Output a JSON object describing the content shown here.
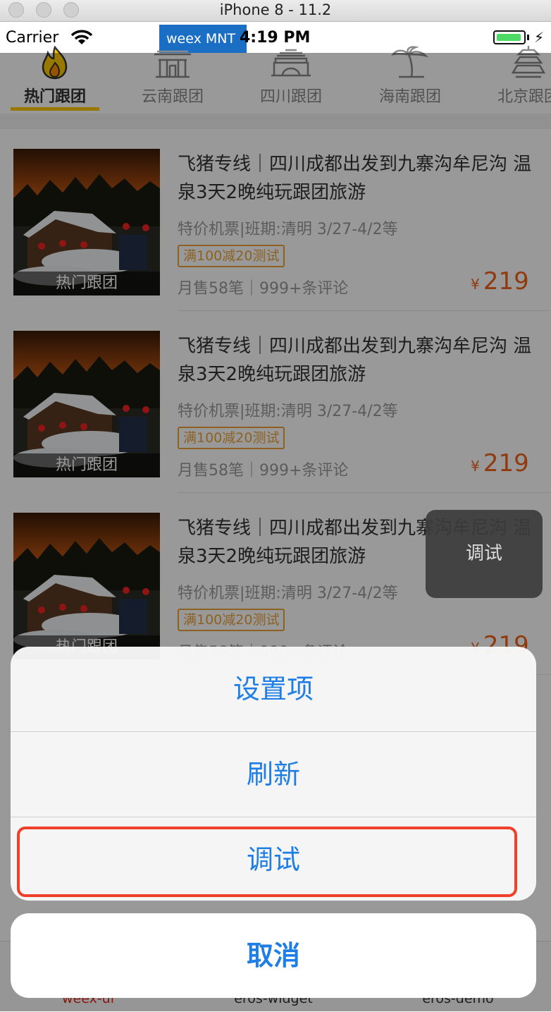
{
  "window": {
    "title": "iPhone 8 - 11.2"
  },
  "status_bar": {
    "carrier": "Carrier",
    "badge": "weex MNT",
    "time": "4:19 PM"
  },
  "category_tabs": [
    {
      "label": "热门跟团",
      "icon": "fire-icon",
      "active": true
    },
    {
      "label": "云南跟团",
      "icon": "temple-gate-icon",
      "active": false
    },
    {
      "label": "四川跟团",
      "icon": "great-wall-icon",
      "active": false
    },
    {
      "label": "海南跟团",
      "icon": "palm-tree-icon",
      "active": false
    },
    {
      "label": "北京跟团",
      "icon": "pagoda-icon",
      "active": false
    }
  ],
  "items": [
    {
      "thumb_label": "热门跟团",
      "title": "飞猪专线｜四川成都出发到九寨沟牟尼沟 温泉3天2晚纯玩跟团旅游",
      "subtitle": "特价机票|班期:清明 3/27-4/2等",
      "coupon": "满100减20测试",
      "sales": "月售58笔｜999+条评论",
      "price_symbol": "¥",
      "price": "219"
    },
    {
      "thumb_label": "热门跟团",
      "title": "飞猪专线｜四川成都出发到九寨沟牟尼沟 温泉3天2晚纯玩跟团旅游",
      "subtitle": "特价机票|班期:清明 3/27-4/2等",
      "coupon": "满100减20测试",
      "sales": "月售58笔｜999+条评论",
      "price_symbol": "¥",
      "price": "219"
    },
    {
      "thumb_label": "热门跟团",
      "title": "飞猪专线｜四川成都出发到九寨沟牟尼沟 温泉3天2晚纯玩跟团旅游",
      "subtitle": "特价机票|班期:清明 3/27-4/2等",
      "coupon": "满100减20测试",
      "sales": "月售58笔｜999+条评论",
      "price_symbol": "¥",
      "price": "219"
    }
  ],
  "tabbar": [
    {
      "label": "weex-ui",
      "color": "#e8251e"
    },
    {
      "label": "eros-widget",
      "color": "#333333"
    },
    {
      "label": "eros-demo",
      "color": "#333333"
    }
  ],
  "debug_float": {
    "label": "调试"
  },
  "action_sheet": {
    "options": [
      "设置项",
      "刷新",
      "调试"
    ],
    "cancel": "取消",
    "highlighted_option": "调试"
  },
  "colors": {
    "accent_blue": "#1f7ee6",
    "price_orange": "#f0621c",
    "tab_underline": "#ffc900",
    "highlight_red": "#f0402a"
  }
}
